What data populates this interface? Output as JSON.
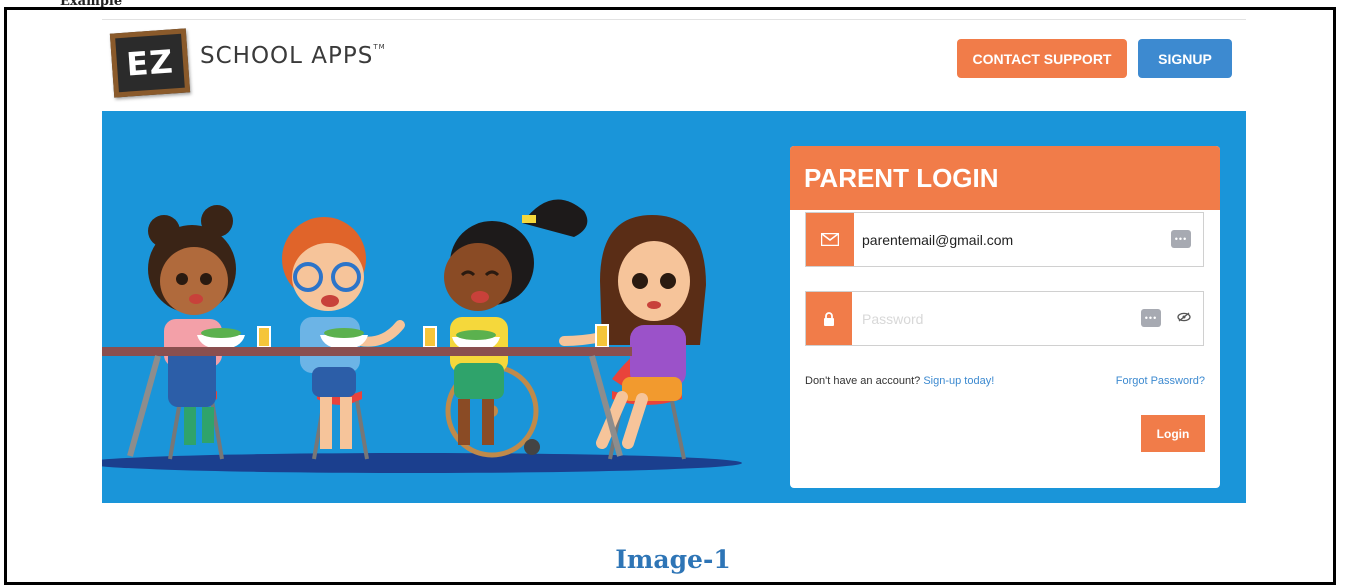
{
  "page": {
    "top_caption": "Example"
  },
  "header": {
    "logo_mark": "EZ",
    "logo_text": "SCHOOL APPS",
    "trademark": "TM",
    "contact_support_label": "CONTACT SUPPORT",
    "signup_label": "SIGNUP"
  },
  "login": {
    "title": "PARENT LOGIN",
    "email_value": "parentemail@gmail.com",
    "email_icon": "envelope-icon",
    "password_placeholder": "Password",
    "password_icon": "lock-icon",
    "keypad_icon": "keyboard-dots-icon",
    "eye_icon": "eye-slash-icon",
    "no_account_text": "Don't have an account?",
    "signup_link": "Sign-up today!",
    "forgot_link": "Forgot Password?",
    "login_button": "Login"
  },
  "colors": {
    "accent_orange": "#f17c49",
    "accent_blue": "#3d8ad0",
    "hero_blue": "#1a95d9"
  },
  "footer": {
    "caption": "Image-1"
  }
}
